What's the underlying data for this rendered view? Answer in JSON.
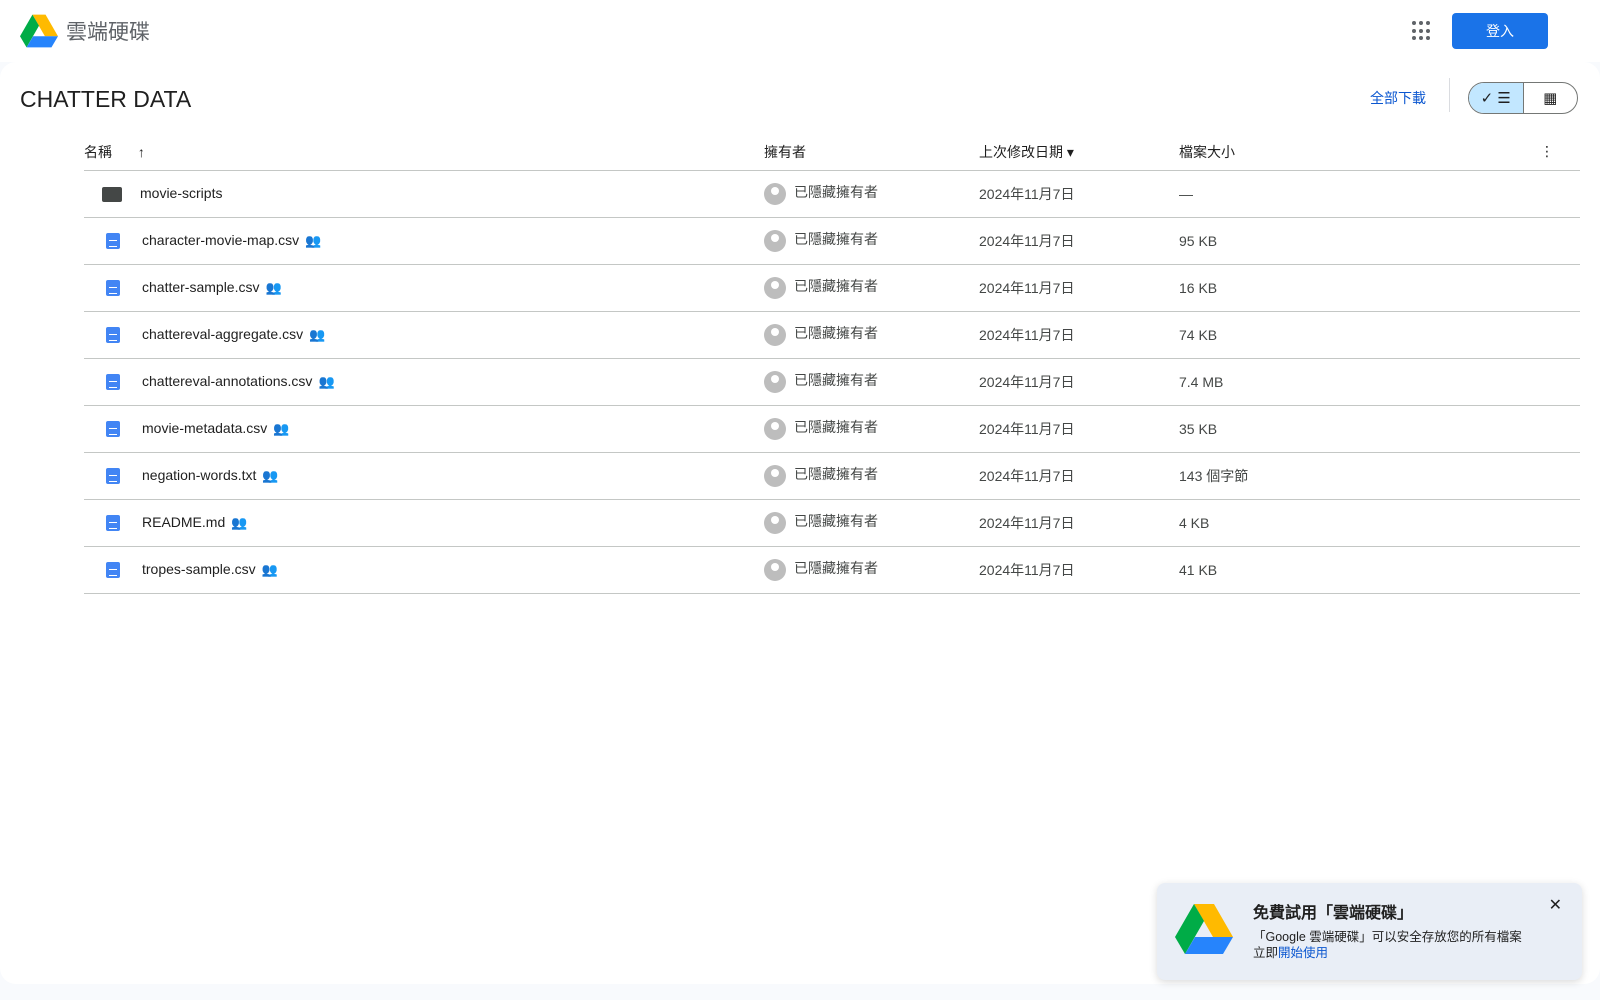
{
  "header": {
    "app_name": "雲端硬碟",
    "signin_label": "登入"
  },
  "folder": {
    "title": "CHATTER DATA",
    "download_all": "全部下載"
  },
  "columns": {
    "name": "名稱",
    "owner": "擁有者",
    "modified": "上次修改日期",
    "size": "檔案大小"
  },
  "rows": [
    {
      "name": "movie-scripts",
      "type": "folder",
      "owner": "已隱藏擁有者",
      "modified": "2024年11月7日",
      "size": "—",
      "shared": false
    },
    {
      "name": "character-movie-map.csv",
      "type": "file",
      "owner": "已隱藏擁有者",
      "modified": "2024年11月7日",
      "size": "95 KB",
      "shared": true
    },
    {
      "name": "chatter-sample.csv",
      "type": "file",
      "owner": "已隱藏擁有者",
      "modified": "2024年11月7日",
      "size": "16 KB",
      "shared": true
    },
    {
      "name": "chattereval-aggregate.csv",
      "type": "file",
      "owner": "已隱藏擁有者",
      "modified": "2024年11月7日",
      "size": "74 KB",
      "shared": true
    },
    {
      "name": "chattereval-annotations.csv",
      "type": "file",
      "owner": "已隱藏擁有者",
      "modified": "2024年11月7日",
      "size": "7.4 MB",
      "shared": true
    },
    {
      "name": "movie-metadata.csv",
      "type": "file",
      "owner": "已隱藏擁有者",
      "modified": "2024年11月7日",
      "size": "35 KB",
      "shared": true
    },
    {
      "name": "negation-words.txt",
      "type": "file",
      "owner": "已隱藏擁有者",
      "modified": "2024年11月7日",
      "size": "143 個字節",
      "shared": true
    },
    {
      "name": "README.md",
      "type": "file",
      "owner": "已隱藏擁有者",
      "modified": "2024年11月7日",
      "size": "4 KB",
      "shared": true
    },
    {
      "name": "tropes-sample.csv",
      "type": "file",
      "owner": "已隱藏擁有者",
      "modified": "2024年11月7日",
      "size": "41 KB",
      "shared": true
    }
  ],
  "promo": {
    "title": "免費試用「雲端硬碟」",
    "body": "「Google 雲端硬碟」可以安全存放您的所有檔案",
    "prefix": "立即",
    "link": "開始使用"
  }
}
